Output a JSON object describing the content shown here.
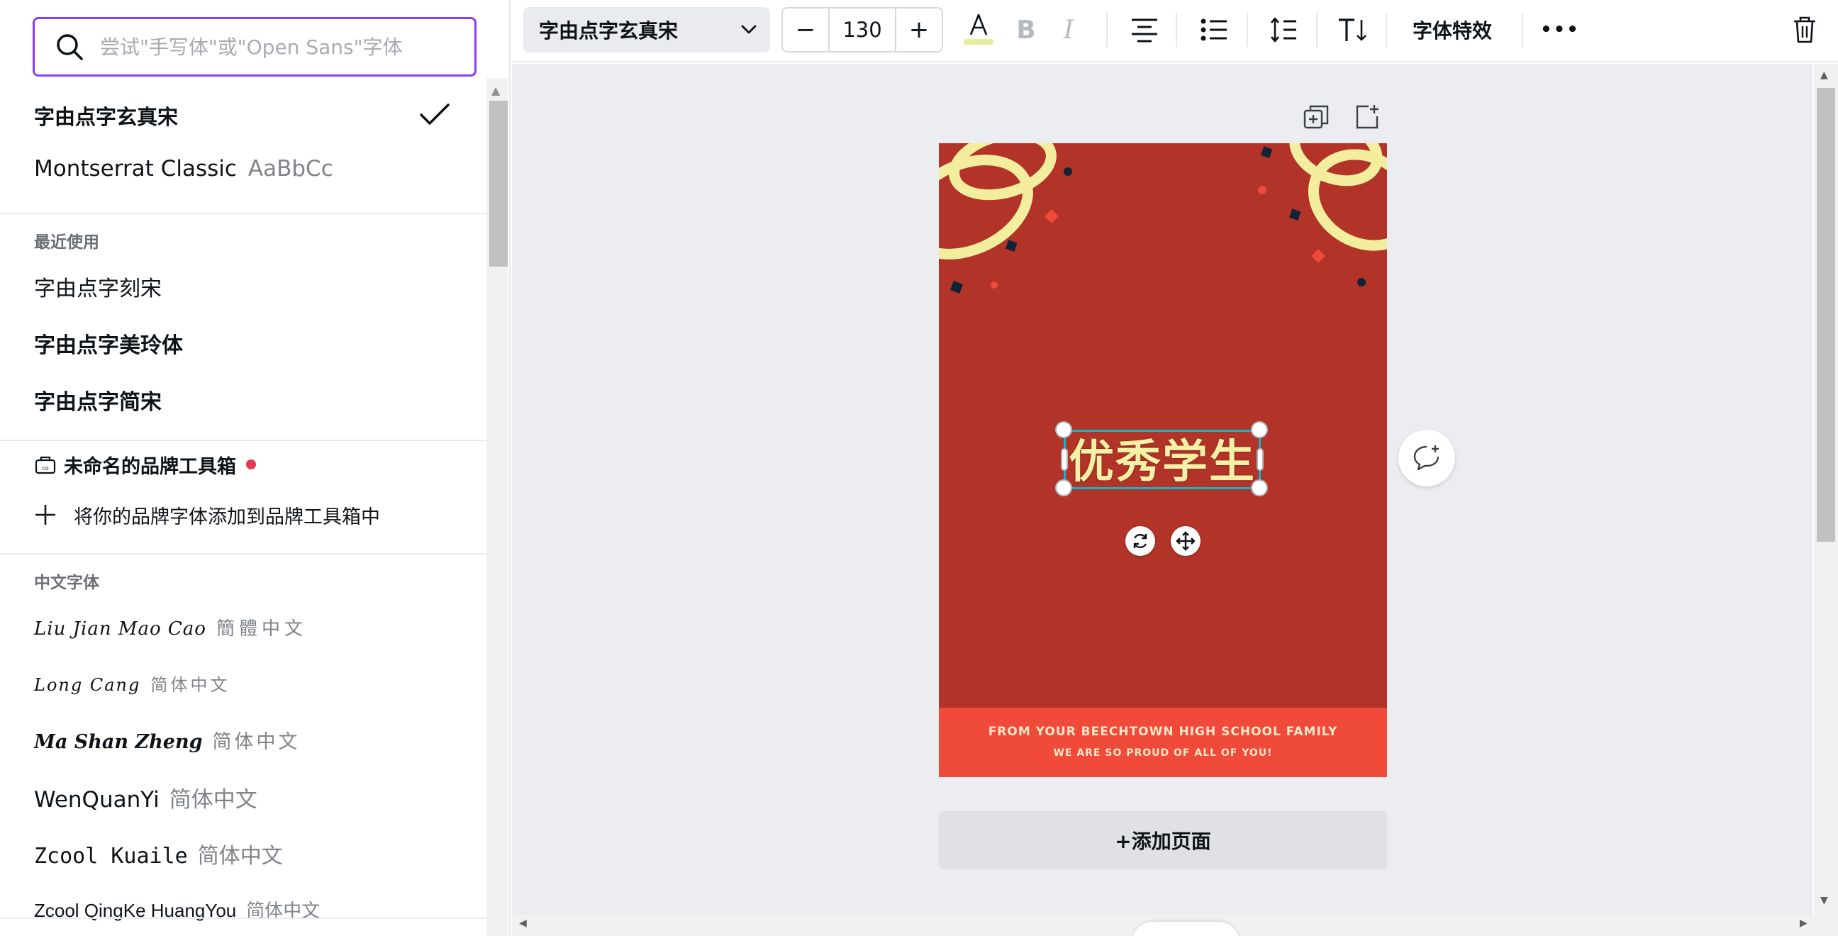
{
  "font_panel": {
    "search_placeholder": "尝试\"手写体\"或\"Open Sans\"字体",
    "selected_font": "字由点字玄真宋",
    "montserrat": {
      "name": "Montserrat Classic",
      "sample": "AaBbCc"
    },
    "recent_label": "最近使用",
    "recent": [
      "字由点字刻宋",
      "字由点字美玲体",
      "字由点字简宋"
    ],
    "brand_kit": {
      "label": "未命名的品牌工具箱",
      "add_label": "将你的品牌字体添加到品牌工具箱中"
    },
    "chinese_label": "中文字体",
    "chinese_fonts": [
      {
        "name": "Liu Jian Mao Cao",
        "sample": "簡體中文"
      },
      {
        "name": "Long Cang",
        "sample": "简体中文"
      },
      {
        "name": "Ma Shan Zheng",
        "sample": "简体中文"
      },
      {
        "name": "WenQuanYi",
        "sample": "简体中文"
      },
      {
        "name": "Zcool Kuaile",
        "sample": "简体中文"
      },
      {
        "name": "Zcool QingKe HuangYou",
        "sample": "简体中文"
      }
    ]
  },
  "toolbar": {
    "font_name": "字由点字玄真宋",
    "font_size": "130",
    "minus": "−",
    "plus": "+",
    "effects_label": "字体特效",
    "more": "•••"
  },
  "design": {
    "title": "优秀学生",
    "footer_line1": "FROM YOUR BEECHTOWN HIGH SCHOOL FAMILY",
    "footer_line2": "WE ARE SO PROUD OF ALL OF YOU!",
    "add_page": "+添加页面"
  },
  "colors": {
    "accent": "#8b3dff",
    "page_bg": "#b23328",
    "footer_bg": "#ef4a3a",
    "title_text": "#f4f0a6",
    "selection": "#12b5cb",
    "brand_dot": "#e7394f"
  }
}
